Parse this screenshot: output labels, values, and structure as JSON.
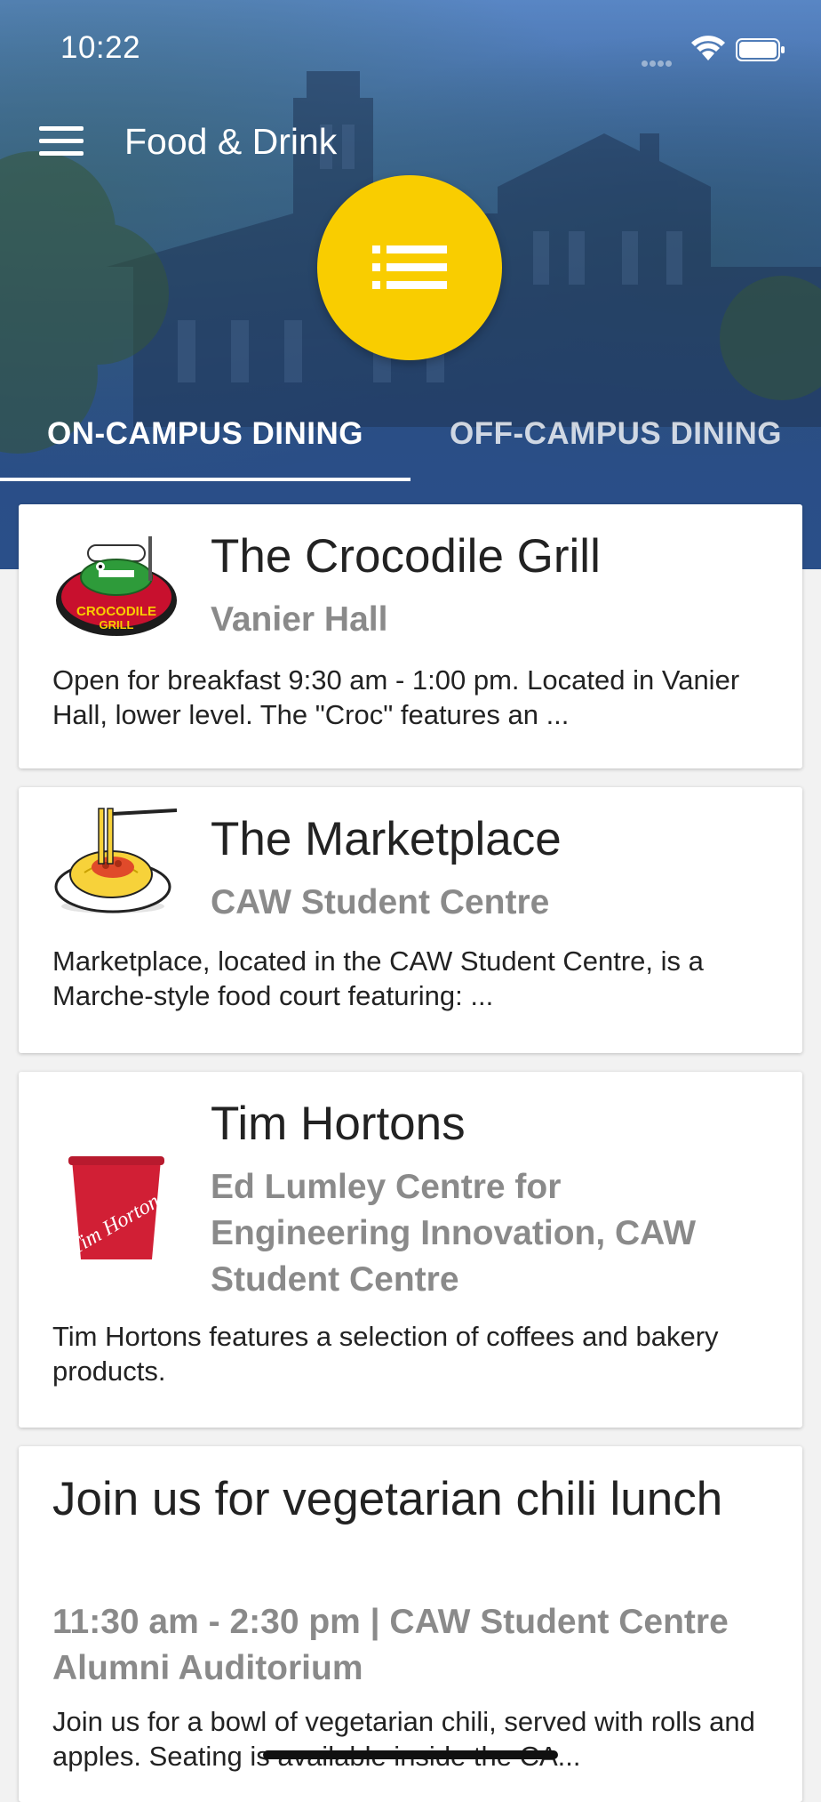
{
  "status_bar": {
    "time": "10:22"
  },
  "header": {
    "title": "Food & Drink"
  },
  "tabs": [
    {
      "label": "ON-CAMPUS DINING",
      "active": true
    },
    {
      "label": "OFF-CAMPUS DINING",
      "active": false
    }
  ],
  "colors": {
    "accent": "#f9cd00",
    "hero": "#2f4a6f"
  },
  "listings": [
    {
      "title": "The Crocodile Grill",
      "location": "Vanier Hall",
      "description": "Open for breakfast 9:30 am - 1:00 pm. Located in Vanier Hall, lower level. The \"Croc\" features an ...",
      "logo_icon": "crocodile-grill-logo",
      "logo_text": "CROCODILE GRILL"
    },
    {
      "title": "The Marketplace",
      "location": "CAW Student Centre",
      "description": "Marketplace, located in the CAW Student Centre, is a Marche-style food court featuring: ...",
      "logo_icon": "spaghetti-icon"
    },
    {
      "title": "Tim Hortons",
      "location": "Ed Lumley Centre for Engineering Innovation, CAW Student Centre",
      "description": "Tim Hortons features a selection of coffees and bakery products.",
      "logo_icon": "tim-hortons-cup-logo",
      "logo_text": "Tim Hortons"
    }
  ],
  "event": {
    "title": "Join us for vegetarian chili lunch",
    "details": "11:30 am - 2:30 pm | CAW Student Centre Alumni Auditorium",
    "description": "Join us for a bowl of vegetarian chili, served with rolls and apples. Seating is available inside the CA..."
  }
}
